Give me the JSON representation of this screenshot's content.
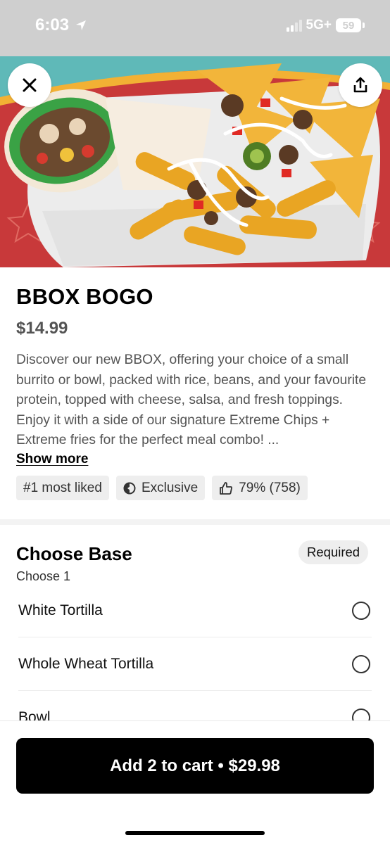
{
  "status_bar": {
    "time": "6:03",
    "network": "5G+",
    "battery": "59",
    "location_icon": "location-arrow-icon"
  },
  "hero": {
    "close_icon": "close-icon",
    "share_icon": "share-icon"
  },
  "item": {
    "title": "BBOX BOGO",
    "price": "$14.99",
    "description": "Discover our new BBOX, offering your choice of a small burrito or bowl, packed with rice, beans, and your favourite protein, topped with cheese, salsa, and fresh toppings. Enjoy it with a side of our signature Extreme Chips + Extreme fries for the perfect meal combo! ...",
    "show_more": "Show more",
    "chips": [
      {
        "label": "#1 most liked",
        "icon": ""
      },
      {
        "label": "Exclusive",
        "icon": "exclusive-icon"
      },
      {
        "label": "79% (758)",
        "icon": "thumbs-up-icon"
      }
    ]
  },
  "section": {
    "title": "Choose Base",
    "subtitle": "Choose 1",
    "required_label": "Required",
    "options": [
      {
        "label": "White Tortilla"
      },
      {
        "label": "Whole Wheat Tortilla"
      },
      {
        "label": "Bowl"
      }
    ]
  },
  "cart": {
    "button_label": "Add 2 to cart • $29.98"
  },
  "colors": {
    "accent": "#000000",
    "hero_red": "#c8393a",
    "hero_teal": "#5fb9b8",
    "chip_bg": "#eeeeee"
  }
}
